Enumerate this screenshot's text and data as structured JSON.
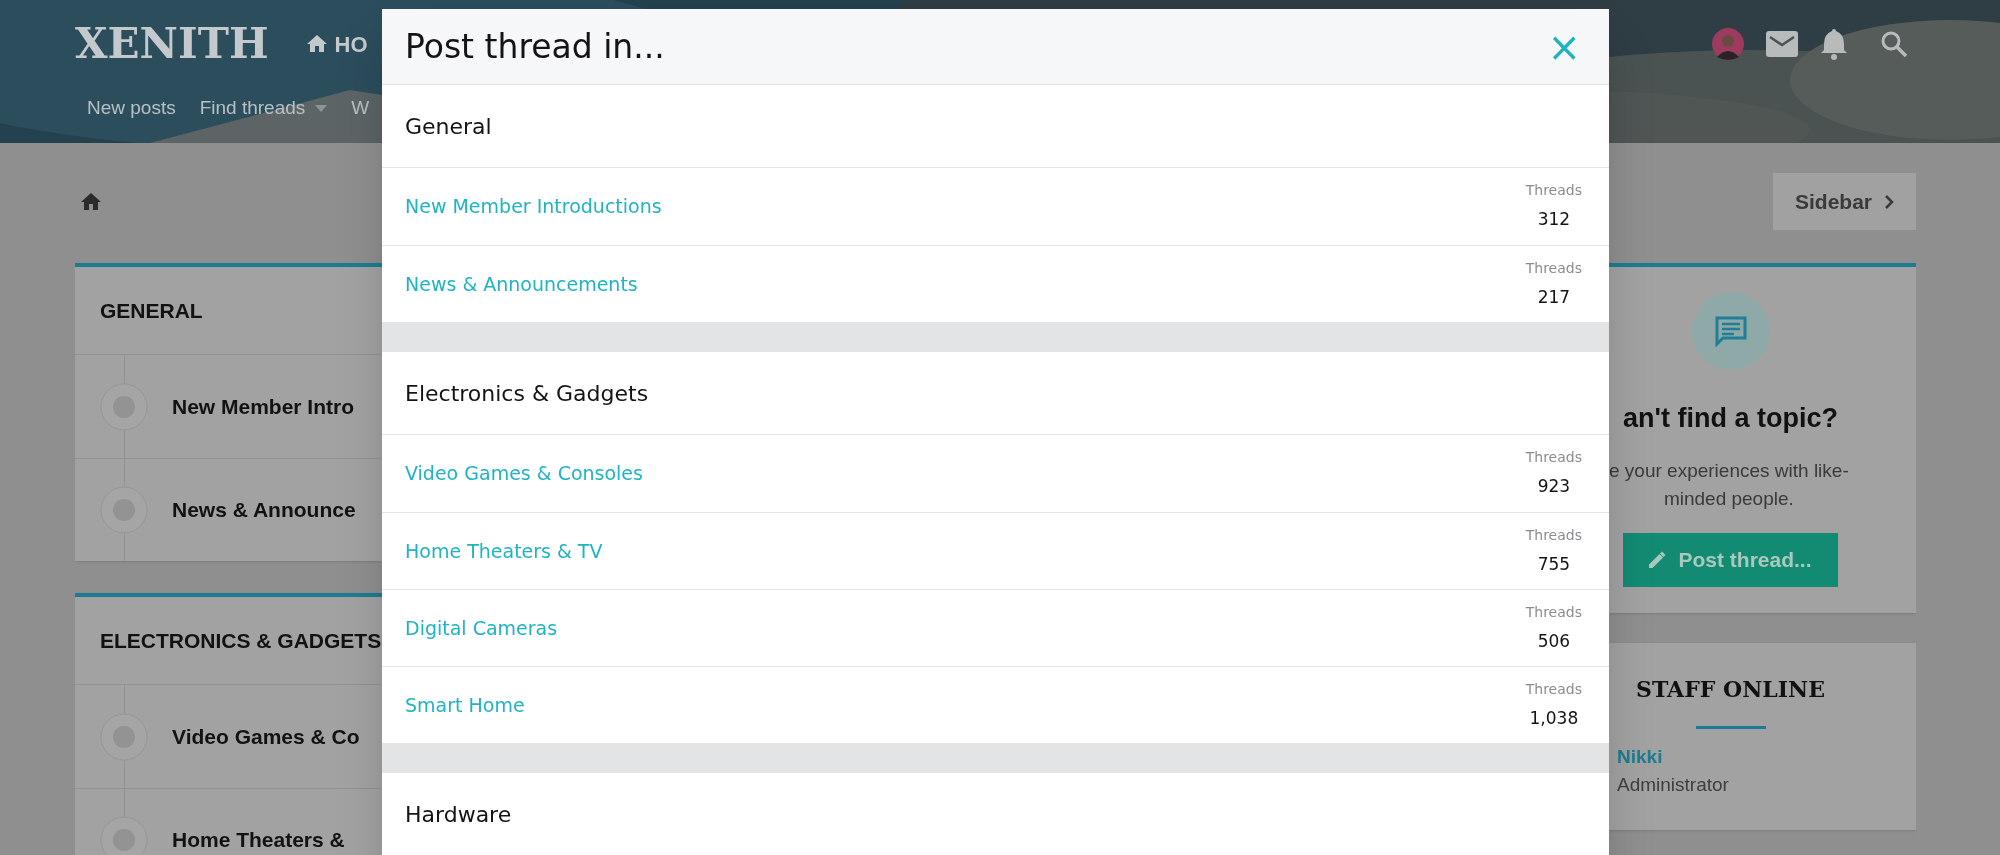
{
  "header": {
    "logo": "XENITH",
    "nav": [
      {
        "label": "HO"
      }
    ],
    "subnav": [
      {
        "label": "New posts",
        "dropdown": false
      },
      {
        "label": "Find threads",
        "dropdown": true
      },
      {
        "label": "W",
        "dropdown": false
      }
    ]
  },
  "sidebar_toggle": {
    "label": "Sidebar"
  },
  "nodes": [
    {
      "title": "GENERAL",
      "forums": [
        "New Member Intro",
        "News & Announce"
      ]
    },
    {
      "title": "ELECTRONICS & GADGETS",
      "forums": [
        "Video Games & Co",
        "Home Theaters &"
      ]
    }
  ],
  "sidebar": {
    "cta": {
      "title": "an't find a topic?",
      "text": "e your experiences with like-\nminded people.",
      "button": "Post thread..."
    },
    "staff": {
      "title": "STAFF ONLINE",
      "members": [
        {
          "name": "Nikki",
          "role": "Administrator"
        }
      ]
    }
  },
  "modal": {
    "title": "Post thread in...",
    "close": "×",
    "sections": [
      {
        "title": "General",
        "forums": [
          {
            "name": "New Member Introductions",
            "stat_label": "Threads",
            "count": "312"
          },
          {
            "name": "News & Announcements",
            "stat_label": "Threads",
            "count": "217"
          }
        ]
      },
      {
        "title": "Electronics & Gadgets",
        "forums": [
          {
            "name": "Video Games & Consoles",
            "stat_label": "Threads",
            "count": "923"
          },
          {
            "name": "Home Theaters & TV",
            "stat_label": "Threads",
            "count": "755"
          },
          {
            "name": "Digital Cameras",
            "stat_label": "Threads",
            "count": "506"
          },
          {
            "name": "Smart Home",
            "stat_label": "Threads",
            "count": "1,038"
          }
        ]
      },
      {
        "title": "Hardware"
      }
    ]
  }
}
